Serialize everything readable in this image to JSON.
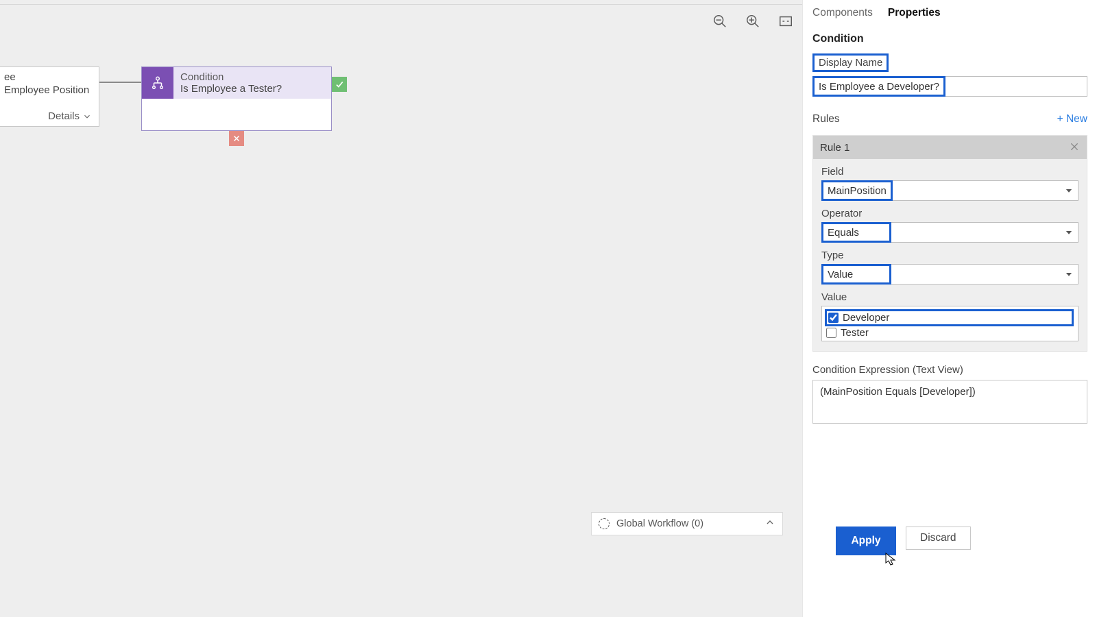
{
  "canvas": {
    "node_partial": {
      "line1": "ee",
      "line2": "Employee Position",
      "details_label": "Details"
    },
    "condition_node": {
      "type_label": "Condition",
      "title": "Is Employee a Tester?"
    },
    "global_workflow_label": "Global Workflow (0)"
  },
  "panel": {
    "tabs": {
      "components": "Components",
      "properties": "Properties",
      "active": "properties"
    },
    "section_title": "Condition",
    "display_name_label": "Display Name",
    "display_name_value": "Is Employee a Developer?",
    "rules_label": "Rules",
    "new_label": "+ New",
    "rule1": {
      "title": "Rule 1",
      "field_label": "Field",
      "field_value": "MainPosition",
      "operator_label": "Operator",
      "operator_value": "Equals",
      "type_label": "Type",
      "type_value": "Value",
      "value_label": "Value",
      "options": {
        "developer": {
          "label": "Developer",
          "checked": true
        },
        "tester": {
          "label": "Tester",
          "checked": false
        }
      }
    },
    "expr_label": "Condition Expression (Text View)",
    "expr_value": "(MainPosition Equals [Developer])",
    "apply_label": "Apply",
    "discard_label": "Discard"
  }
}
